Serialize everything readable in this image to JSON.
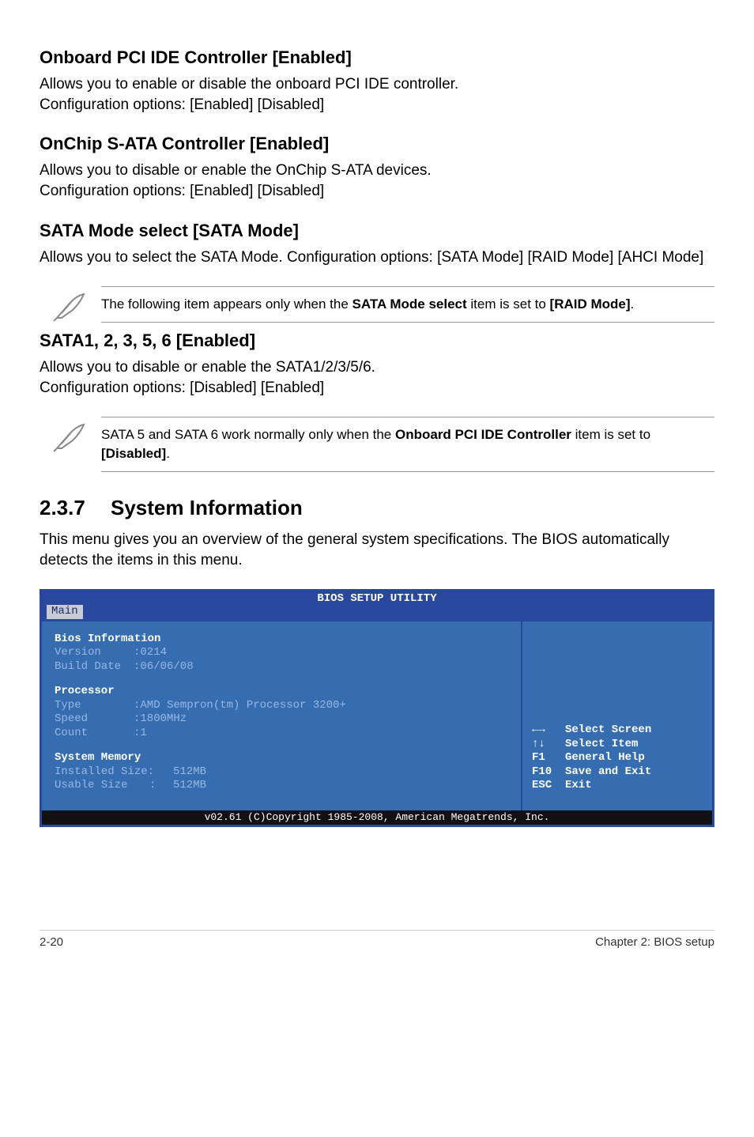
{
  "s1": {
    "title": "Onboard PCI IDE Controller [Enabled]",
    "p1": "Allows you to enable or disable the onboard PCI IDE controller.",
    "p2": "Configuration options: [Enabled] [Disabled]"
  },
  "s2": {
    "title": "OnChip S-ATA Controller [Enabled]",
    "p1": "Allows you to disable or enable the OnChip S-ATA devices.",
    "p2": "Configuration options: [Enabled] [Disabled]"
  },
  "s3": {
    "title": "SATA Mode select [SATA Mode]",
    "p1": "Allows you to select the SATA Mode. Configuration options: [SATA Mode] [RAID Mode] [AHCI Mode]"
  },
  "note1": {
    "pre": "The following item appears only when the ",
    "bold1": "SATA Mode select",
    "mid": " item is set to ",
    "bold2": "[RAID Mode]",
    "end": "."
  },
  "s4": {
    "title": "SATA1, 2, 3, 5, 6 [Enabled]",
    "p1": "Allows you to disable or enable the SATA1/2/3/5/6.",
    "p2": "Configuration options: [Disabled] [Enabled]"
  },
  "note2": {
    "pre": "SATA 5 and SATA 6 work normally only when the ",
    "bold1": "Onboard PCI IDE Controller",
    "mid": " item is set to ",
    "bold2": "[Disabled]",
    "end": "."
  },
  "sec": {
    "num": "2.3.7",
    "title": "System Information",
    "p1": "This menu gives you an overview of the general system specifications. The BIOS automatically detects the items in this menu."
  },
  "bios": {
    "title": "BIOS SETUP UTILITY",
    "tab": "Main",
    "h1": "Bios Information",
    "version_label": "Version",
    "version_val": ":0214",
    "build_label": "Build Date",
    "build_val": ":06/06/08",
    "h2": "Processor",
    "type_label": "Type",
    "type_val": ":AMD Sempron(tm) Processor 3200+",
    "speed_label": "Speed",
    "speed_val": ":1800MHz",
    "count_label": "Count",
    "count_val": ":1",
    "h3": "System Memory",
    "inst_label": "Installed Size:",
    "inst_val": "512MB",
    "usable_label": "Usable Size",
    "usable_sep": ":",
    "usable_val": "512MB",
    "help": {
      "r1": "Select Screen",
      "r2": "Select Item",
      "r3k": "F1",
      "r3v": "General Help",
      "r4k": "F10",
      "r4v": "Save and Exit",
      "r5k": "ESC",
      "r5v": "Exit"
    },
    "footer": "v02.61 (C)Copyright 1985-2008, American Megatrends, Inc."
  },
  "pagefoot": {
    "left": "2-20",
    "right": "Chapter 2: BIOS setup"
  }
}
